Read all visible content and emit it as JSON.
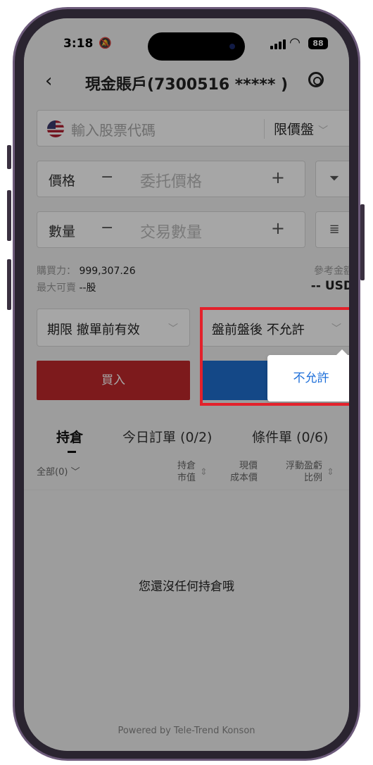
{
  "status": {
    "time": "3:18",
    "battery": "88"
  },
  "nav": {
    "title": "現金賬戶(7300516 ***** )"
  },
  "stock": {
    "placeholder": "輸入股票代碼",
    "order_type": "限價盤"
  },
  "price": {
    "label": "價格",
    "placeholder": "委托價格"
  },
  "quantity": {
    "label": "數量",
    "placeholder": "交易數量"
  },
  "account": {
    "buying_power_label": "購買力：",
    "buying_power_value": "999,307.26",
    "max_sell_label": "最大可賣",
    "max_sell_value": "--股",
    "ref_amount_label": "參考金額",
    "ref_amount_value": "-- USD"
  },
  "validity": {
    "label": "期限",
    "value": "撤單前有效"
  },
  "extended_hours": {
    "label": "盤前盤後",
    "value": "不允許"
  },
  "popup_option": "不允許",
  "buy_label": "買入",
  "tabs": [
    "持倉",
    "今日訂單 (0/2)",
    "條件單 (0/6)"
  ],
  "table_header": {
    "filter": "全部(0)",
    "col1_top": "持倉",
    "col1_bottom": "市值",
    "col2_top": "現價",
    "col2_bottom": "成本價",
    "col3_top": "浮動盈虧",
    "col3_bottom": "比例"
  },
  "empty_message": "您還沒任何持倉哦",
  "powered_by": "Powered by Tele-Trend Konson"
}
